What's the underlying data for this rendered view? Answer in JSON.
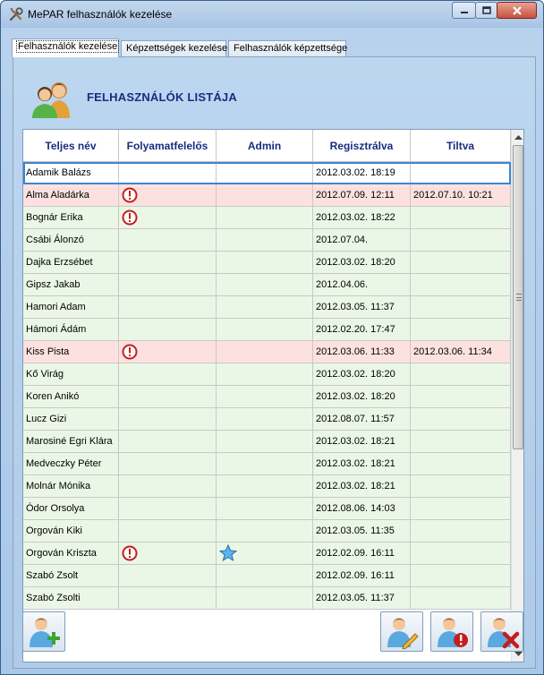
{
  "window": {
    "title": "MePAR felhasználók kezelése"
  },
  "tabs": [
    {
      "label": "Felhasználók kezelése",
      "active": true
    },
    {
      "label": "Képzettségek kezelése",
      "active": false
    },
    {
      "label": "Felhasználók képzettsége",
      "active": false
    }
  ],
  "header": {
    "title": "FELHASZNÁLÓK LISTÁJA",
    "icon": "users-icon"
  },
  "table": {
    "columns": [
      "Teljes név",
      "Folyamatfelelős",
      "Admin",
      "Regisztrálva",
      "Tiltva"
    ],
    "rows": [
      {
        "name": "Adamik Balázs",
        "process_owner": false,
        "admin": false,
        "registered": "2012.03.02. 18:19",
        "banned": "",
        "state": "selected"
      },
      {
        "name": "Alma Aladárka",
        "process_owner": true,
        "admin": false,
        "registered": "2012.07.09. 12:11",
        "banned": "2012.07.10. 10:21",
        "state": "flagged"
      },
      {
        "name": "Bognár Erika",
        "process_owner": true,
        "admin": false,
        "registered": "2012.03.02. 18:22",
        "banned": "",
        "state": "normal"
      },
      {
        "name": "Csábi Álonzó",
        "process_owner": false,
        "admin": false,
        "registered": "2012.07.04.",
        "banned": "",
        "state": "normal"
      },
      {
        "name": "Dajka Erzsébet",
        "process_owner": false,
        "admin": false,
        "registered": "2012.03.02. 18:20",
        "banned": "",
        "state": "normal"
      },
      {
        "name": "Gipsz Jakab",
        "process_owner": false,
        "admin": false,
        "registered": "2012.04.06.",
        "banned": "",
        "state": "normal"
      },
      {
        "name": "Hamori Adam",
        "process_owner": false,
        "admin": false,
        "registered": "2012.03.05. 11:37",
        "banned": "",
        "state": "normal"
      },
      {
        "name": "Hámori Ádám",
        "process_owner": false,
        "admin": false,
        "registered": "2012.02.20. 17:47",
        "banned": "",
        "state": "normal"
      },
      {
        "name": "Kiss Pista",
        "process_owner": true,
        "admin": false,
        "registered": "2012.03.06. 11:33",
        "banned": "2012.03.06. 11:34",
        "state": "flagged"
      },
      {
        "name": "Kő Virág",
        "process_owner": false,
        "admin": false,
        "registered": "2012.03.02. 18:20",
        "banned": "",
        "state": "normal"
      },
      {
        "name": "Koren Anikó",
        "process_owner": false,
        "admin": false,
        "registered": "2012.03.02. 18:20",
        "banned": "",
        "state": "normal"
      },
      {
        "name": "Lucz Gizi",
        "process_owner": false,
        "admin": false,
        "registered": "2012.08.07. 11:57",
        "banned": "",
        "state": "normal"
      },
      {
        "name": "Marosiné Egri Klára",
        "process_owner": false,
        "admin": false,
        "registered": "2012.03.02. 18:21",
        "banned": "",
        "state": "normal"
      },
      {
        "name": "Medveczky Péter",
        "process_owner": false,
        "admin": false,
        "registered": "2012.03.02. 18:21",
        "banned": "",
        "state": "normal"
      },
      {
        "name": "Molnár Mónika",
        "process_owner": false,
        "admin": false,
        "registered": "2012.03.02. 18:21",
        "banned": "",
        "state": "normal"
      },
      {
        "name": "Ódor Orsolya",
        "process_owner": false,
        "admin": false,
        "registered": "2012.08.06. 14:03",
        "banned": "",
        "state": "normal"
      },
      {
        "name": "Orgován Kiki",
        "process_owner": false,
        "admin": false,
        "registered": "2012.03.05. 11:35",
        "banned": "",
        "state": "normal"
      },
      {
        "name": "Orgován Kriszta",
        "process_owner": true,
        "admin": true,
        "registered": "2012.02.09. 16:11",
        "banned": "",
        "state": "normal"
      },
      {
        "name": "Szabó Zsolt",
        "process_owner": false,
        "admin": false,
        "registered": "2012.02.09. 16:11",
        "banned": "",
        "state": "normal"
      },
      {
        "name": "Szabó Zsolti",
        "process_owner": false,
        "admin": false,
        "registered": "2012.03.05. 11:37",
        "banned": "",
        "state": "normal"
      }
    ]
  },
  "icons": {
    "process_owner": "alert-circle-icon",
    "admin": "star-icon"
  },
  "buttons": {
    "add_user": "add-user-icon",
    "edit_user": "edit-user-icon",
    "ban_user": "ban-user-icon",
    "delete_user": "delete-user-icon"
  },
  "colors": {
    "header_text": "#1b2c7e",
    "row_normal": "#ebf7e6",
    "row_flagged": "#fde1e1",
    "selection": "#3a86d1",
    "alert": "#c41e1e",
    "star": "#49a7e6"
  }
}
